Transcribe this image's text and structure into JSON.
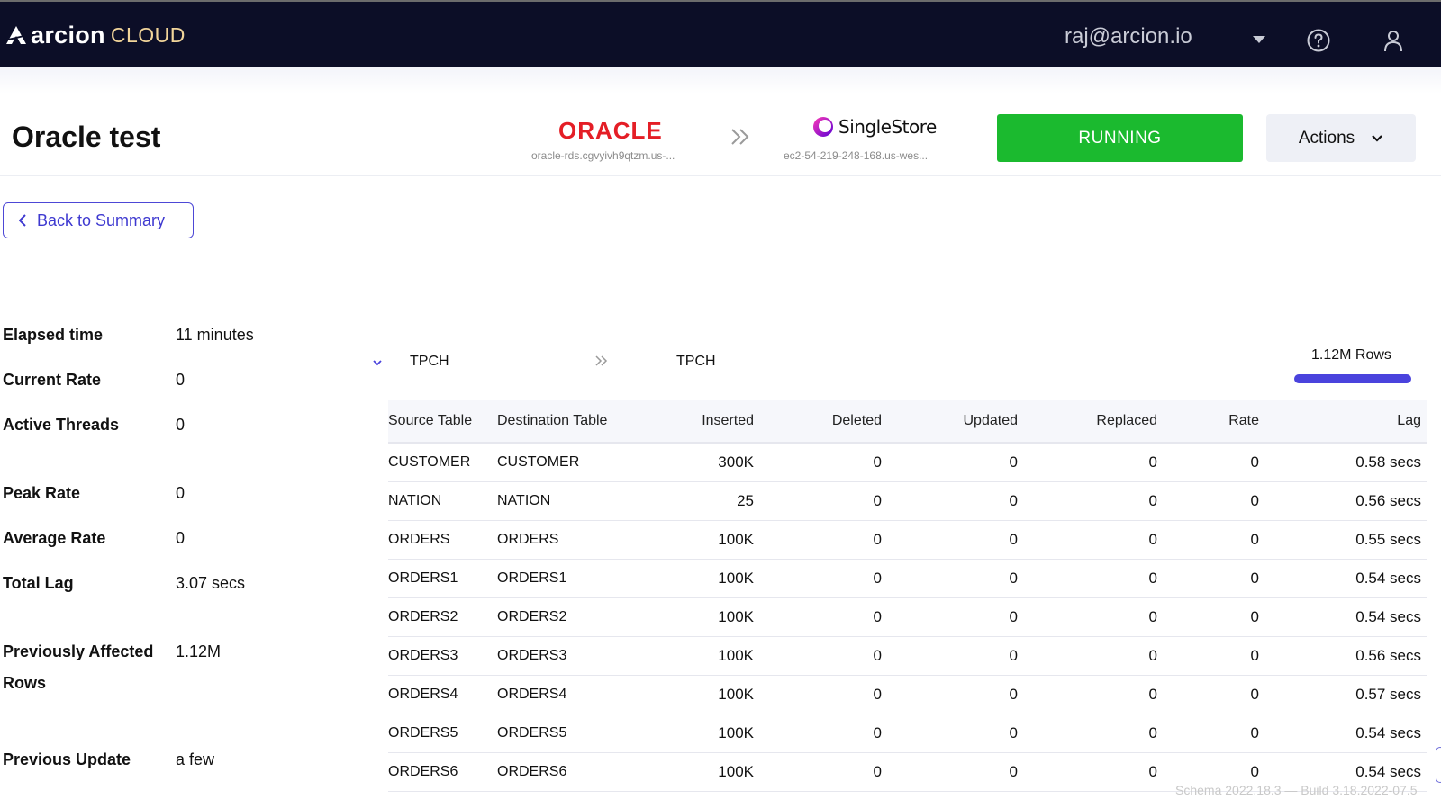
{
  "header": {
    "brand_main": "arcion",
    "brand_sub": "CLOUD",
    "user_email": "raj@arcion.io",
    "colors": {
      "bar": "#0c0e27",
      "brand_sub": "#f2d59a"
    }
  },
  "pipeline": {
    "title": "Oracle test",
    "source": {
      "name": "ORACLE",
      "host": "oracle-rds.cgvyivh9qtzm.us-..."
    },
    "destination": {
      "name": "SingleStore",
      "host": "ec2-54-219-248-168.us-wes..."
    },
    "status": "RUNNING",
    "status_color": "#1bba2f",
    "actions_label": "Actions"
  },
  "back_button": "Back to Summary",
  "stats": {
    "elapsed_label": "Elapsed time",
    "elapsed_value": "11 minutes",
    "current_rate_label": "Current Rate",
    "current_rate_value": "0",
    "active_threads_label": "Active Threads",
    "active_threads_value": "0",
    "peak_rate_label": "Peak Rate",
    "peak_rate_value": "0",
    "average_rate_label": "Average Rate",
    "average_rate_value": "0",
    "total_lag_label": "Total Lag",
    "total_lag_value": "3.07 secs",
    "prev_affected_label_1": "Previously Affected",
    "prev_affected_label_2": "Rows",
    "prev_affected_value": "1.12M",
    "prev_update_label": "Previous Update",
    "prev_update_value": "a few"
  },
  "schema_group": {
    "source_schema": "TPCH",
    "destination_schema": "TPCH",
    "rows_label": "1.12M Rows",
    "progress_fraction": 1.0
  },
  "table": {
    "headers": [
      "Source Table",
      "Destination Table",
      "Inserted",
      "Deleted",
      "Updated",
      "Replaced",
      "Rate",
      "Lag"
    ],
    "rows": [
      [
        "CUSTOMER",
        "CUSTOMER",
        "300K",
        "0",
        "0",
        "0",
        "0",
        "0.58 secs"
      ],
      [
        "NATION",
        "NATION",
        "25",
        "0",
        "0",
        "0",
        "0",
        "0.56 secs"
      ],
      [
        "ORDERS",
        "ORDERS",
        "100K",
        "0",
        "0",
        "0",
        "0",
        "0.55 secs"
      ],
      [
        "ORDERS1",
        "ORDERS1",
        "100K",
        "0",
        "0",
        "0",
        "0",
        "0.54 secs"
      ],
      [
        "ORDERS2",
        "ORDERS2",
        "100K",
        "0",
        "0",
        "0",
        "0",
        "0.54 secs"
      ],
      [
        "ORDERS3",
        "ORDERS3",
        "100K",
        "0",
        "0",
        "0",
        "0",
        "0.56 secs"
      ],
      [
        "ORDERS4",
        "ORDERS4",
        "100K",
        "0",
        "0",
        "0",
        "0",
        "0.57 secs"
      ],
      [
        "ORDERS5",
        "ORDERS5",
        "100K",
        "0",
        "0",
        "0",
        "0",
        "0.54 secs"
      ],
      [
        "ORDERS6",
        "ORDERS6",
        "100K",
        "0",
        "0",
        "0",
        "0",
        "0.54 secs"
      ]
    ]
  },
  "footer": {
    "version": "Schema 2022.18.3 — Build 3.18.2022-07.5"
  }
}
